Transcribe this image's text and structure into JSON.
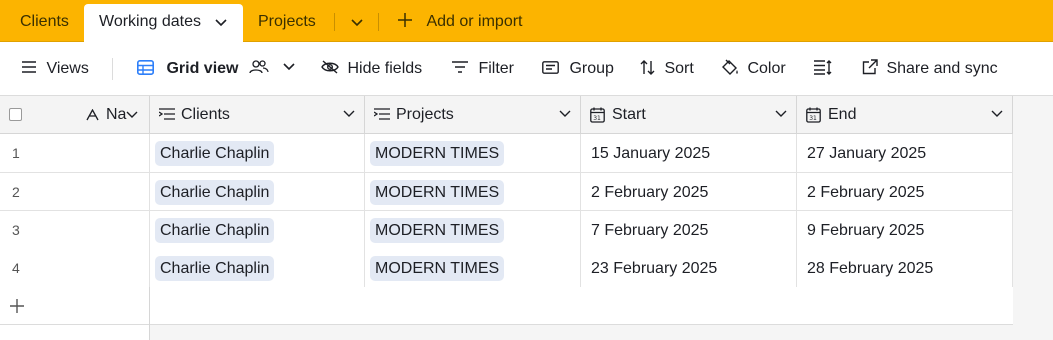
{
  "tabs": {
    "clients": "Clients",
    "working_dates": "Working dates",
    "projects": "Projects",
    "add_or_import": "Add or import"
  },
  "toolbar": {
    "views": "Views",
    "grid_view": "Grid view",
    "hide_fields": "Hide fields",
    "filter": "Filter",
    "group": "Group",
    "sort": "Sort",
    "color": "Color",
    "share_and_sync": "Share and sync"
  },
  "columns": {
    "name": "Na",
    "clients": "Clients",
    "projects": "Projects",
    "start": "Start",
    "end": "End"
  },
  "rows": [
    {
      "num": "1",
      "client": "Charlie Chaplin",
      "project": "MODERN TIMES",
      "start": "15 January 2025",
      "end": "27 January 2025"
    },
    {
      "num": "2",
      "client": "Charlie Chaplin",
      "project": "MODERN TIMES",
      "start": "2 February 2025",
      "end": "2 February 2025"
    },
    {
      "num": "3",
      "client": "Charlie Chaplin",
      "project": "MODERN TIMES",
      "start": "7 February 2025",
      "end": "9 February 2025"
    },
    {
      "num": "4",
      "client": "Charlie Chaplin",
      "project": "MODERN TIMES",
      "start": "23 February 2025",
      "end": "28 February 2025"
    }
  ],
  "colors": {
    "tabbar": "#fcb400",
    "chip": "#e3e9f4",
    "grid_view_icon": "#2d7ff9"
  }
}
